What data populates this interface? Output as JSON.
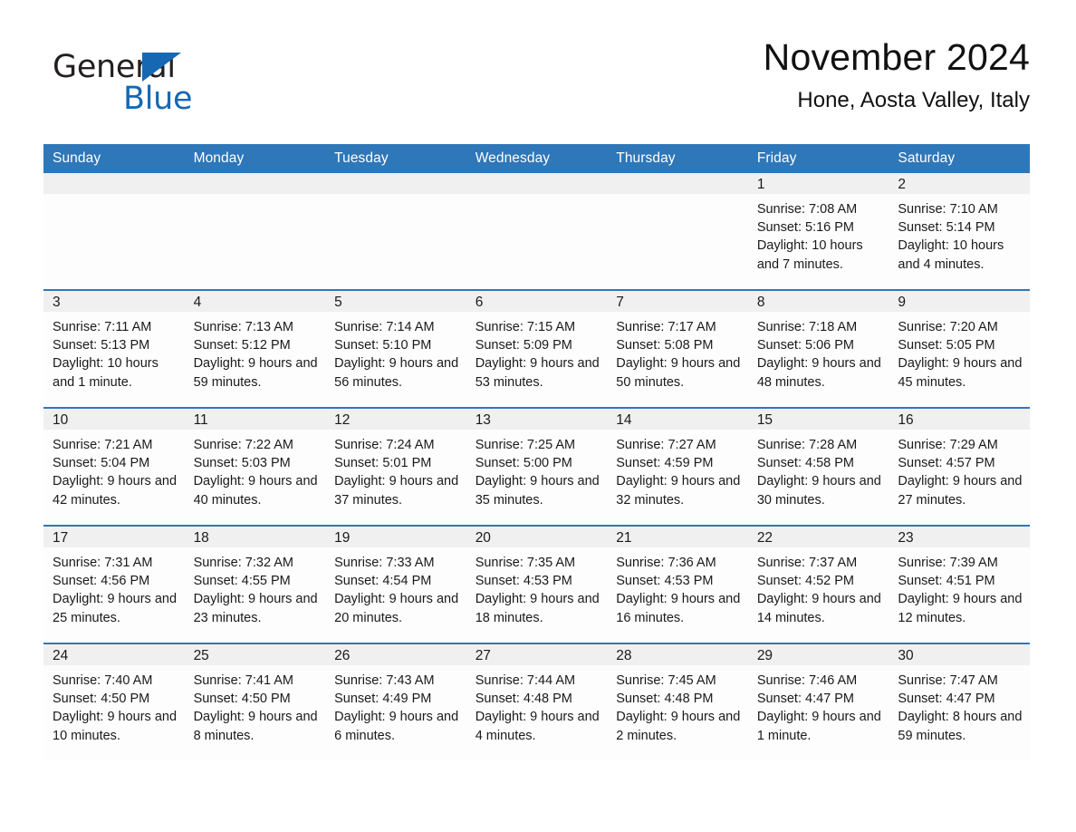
{
  "logo": {
    "word_one": "General",
    "word_two": "Blue",
    "triangle_color": "#1668b3"
  },
  "header": {
    "month_title": "November 2024",
    "location": "Hone, Aosta Valley, Italy"
  },
  "theme": {
    "header_blue": "#2e77b9",
    "row_divider_blue": "#2e77b9",
    "daynum_band": "#f0f0f0",
    "text": "#1a1a1a"
  },
  "weekdays": [
    "Sunday",
    "Monday",
    "Tuesday",
    "Wednesday",
    "Thursday",
    "Friday",
    "Saturday"
  ],
  "weeks": [
    [
      {
        "day": ""
      },
      {
        "day": ""
      },
      {
        "day": ""
      },
      {
        "day": ""
      },
      {
        "day": ""
      },
      {
        "day": "1",
        "sunrise": "Sunrise: 7:08 AM",
        "sunset": "Sunset: 5:16 PM",
        "daylight": "Daylight: 10 hours and 7 minutes."
      },
      {
        "day": "2",
        "sunrise": "Sunrise: 7:10 AM",
        "sunset": "Sunset: 5:14 PM",
        "daylight": "Daylight: 10 hours and 4 minutes."
      }
    ],
    [
      {
        "day": "3",
        "sunrise": "Sunrise: 7:11 AM",
        "sunset": "Sunset: 5:13 PM",
        "daylight": "Daylight: 10 hours and 1 minute."
      },
      {
        "day": "4",
        "sunrise": "Sunrise: 7:13 AM",
        "sunset": "Sunset: 5:12 PM",
        "daylight": "Daylight: 9 hours and 59 minutes."
      },
      {
        "day": "5",
        "sunrise": "Sunrise: 7:14 AM",
        "sunset": "Sunset: 5:10 PM",
        "daylight": "Daylight: 9 hours and 56 minutes."
      },
      {
        "day": "6",
        "sunrise": "Sunrise: 7:15 AM",
        "sunset": "Sunset: 5:09 PM",
        "daylight": "Daylight: 9 hours and 53 minutes."
      },
      {
        "day": "7",
        "sunrise": "Sunrise: 7:17 AM",
        "sunset": "Sunset: 5:08 PM",
        "daylight": "Daylight: 9 hours and 50 minutes."
      },
      {
        "day": "8",
        "sunrise": "Sunrise: 7:18 AM",
        "sunset": "Sunset: 5:06 PM",
        "daylight": "Daylight: 9 hours and 48 minutes."
      },
      {
        "day": "9",
        "sunrise": "Sunrise: 7:20 AM",
        "sunset": "Sunset: 5:05 PM",
        "daylight": "Daylight: 9 hours and 45 minutes."
      }
    ],
    [
      {
        "day": "10",
        "sunrise": "Sunrise: 7:21 AM",
        "sunset": "Sunset: 5:04 PM",
        "daylight": "Daylight: 9 hours and 42 minutes."
      },
      {
        "day": "11",
        "sunrise": "Sunrise: 7:22 AM",
        "sunset": "Sunset: 5:03 PM",
        "daylight": "Daylight: 9 hours and 40 minutes."
      },
      {
        "day": "12",
        "sunrise": "Sunrise: 7:24 AM",
        "sunset": "Sunset: 5:01 PM",
        "daylight": "Daylight: 9 hours and 37 minutes."
      },
      {
        "day": "13",
        "sunrise": "Sunrise: 7:25 AM",
        "sunset": "Sunset: 5:00 PM",
        "daylight": "Daylight: 9 hours and 35 minutes."
      },
      {
        "day": "14",
        "sunrise": "Sunrise: 7:27 AM",
        "sunset": "Sunset: 4:59 PM",
        "daylight": "Daylight: 9 hours and 32 minutes."
      },
      {
        "day": "15",
        "sunrise": "Sunrise: 7:28 AM",
        "sunset": "Sunset: 4:58 PM",
        "daylight": "Daylight: 9 hours and 30 minutes."
      },
      {
        "day": "16",
        "sunrise": "Sunrise: 7:29 AM",
        "sunset": "Sunset: 4:57 PM",
        "daylight": "Daylight: 9 hours and 27 minutes."
      }
    ],
    [
      {
        "day": "17",
        "sunrise": "Sunrise: 7:31 AM",
        "sunset": "Sunset: 4:56 PM",
        "daylight": "Daylight: 9 hours and 25 minutes."
      },
      {
        "day": "18",
        "sunrise": "Sunrise: 7:32 AM",
        "sunset": "Sunset: 4:55 PM",
        "daylight": "Daylight: 9 hours and 23 minutes."
      },
      {
        "day": "19",
        "sunrise": "Sunrise: 7:33 AM",
        "sunset": "Sunset: 4:54 PM",
        "daylight": "Daylight: 9 hours and 20 minutes."
      },
      {
        "day": "20",
        "sunrise": "Sunrise: 7:35 AM",
        "sunset": "Sunset: 4:53 PM",
        "daylight": "Daylight: 9 hours and 18 minutes."
      },
      {
        "day": "21",
        "sunrise": "Sunrise: 7:36 AM",
        "sunset": "Sunset: 4:53 PM",
        "daylight": "Daylight: 9 hours and 16 minutes."
      },
      {
        "day": "22",
        "sunrise": "Sunrise: 7:37 AM",
        "sunset": "Sunset: 4:52 PM",
        "daylight": "Daylight: 9 hours and 14 minutes."
      },
      {
        "day": "23",
        "sunrise": "Sunrise: 7:39 AM",
        "sunset": "Sunset: 4:51 PM",
        "daylight": "Daylight: 9 hours and 12 minutes."
      }
    ],
    [
      {
        "day": "24",
        "sunrise": "Sunrise: 7:40 AM",
        "sunset": "Sunset: 4:50 PM",
        "daylight": "Daylight: 9 hours and 10 minutes."
      },
      {
        "day": "25",
        "sunrise": "Sunrise: 7:41 AM",
        "sunset": "Sunset: 4:50 PM",
        "daylight": "Daylight: 9 hours and 8 minutes."
      },
      {
        "day": "26",
        "sunrise": "Sunrise: 7:43 AM",
        "sunset": "Sunset: 4:49 PM",
        "daylight": "Daylight: 9 hours and 6 minutes."
      },
      {
        "day": "27",
        "sunrise": "Sunrise: 7:44 AM",
        "sunset": "Sunset: 4:48 PM",
        "daylight": "Daylight: 9 hours and 4 minutes."
      },
      {
        "day": "28",
        "sunrise": "Sunrise: 7:45 AM",
        "sunset": "Sunset: 4:48 PM",
        "daylight": "Daylight: 9 hours and 2 minutes."
      },
      {
        "day": "29",
        "sunrise": "Sunrise: 7:46 AM",
        "sunset": "Sunset: 4:47 PM",
        "daylight": "Daylight: 9 hours and 1 minute."
      },
      {
        "day": "30",
        "sunrise": "Sunrise: 7:47 AM",
        "sunset": "Sunset: 4:47 PM",
        "daylight": "Daylight: 8 hours and 59 minutes."
      }
    ]
  ]
}
